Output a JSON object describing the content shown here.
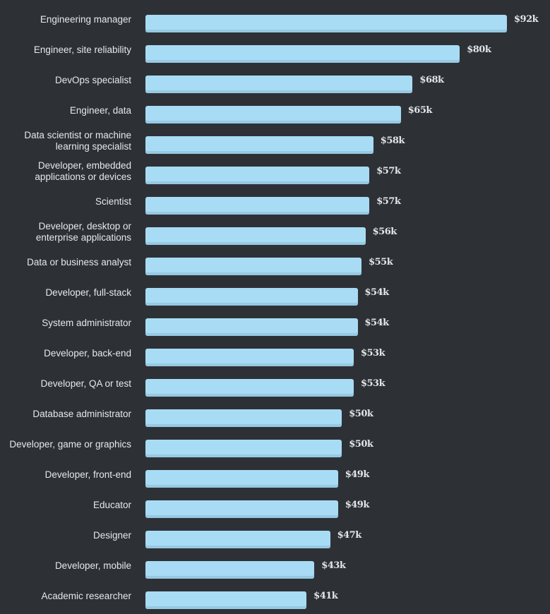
{
  "chart_data": {
    "type": "bar",
    "orientation": "horizontal",
    "title": "",
    "xlabel": "",
    "ylabel": "",
    "xlim": [
      0,
      92
    ],
    "grid": false,
    "value_prefix": "$",
    "value_suffix": "k",
    "categories": [
      "Engineering manager",
      "Engineer, site reliability",
      "DevOps specialist",
      "Engineer, data",
      "Data scientist or machine\nlearning specialist",
      "Developer, embedded\napplications or devices",
      "Scientist",
      "Developer, desktop or\nenterprise applications",
      "Data or business analyst",
      "Developer, full-stack",
      "System administrator",
      "Developer, back-end",
      "Developer, QA or test",
      "Database administrator",
      "Developer, game or graphics",
      "Developer, front-end",
      "Educator",
      "Designer",
      "Developer, mobile",
      "Academic researcher"
    ],
    "values": [
      92,
      80,
      68,
      65,
      58,
      57,
      57,
      56,
      55,
      54,
      54,
      53,
      53,
      50,
      50,
      49,
      49,
      47,
      43,
      41
    ],
    "data_labels": [
      "$92k",
      "$80k",
      "$68k",
      "$65k",
      "$58k",
      "$57k",
      "$57k",
      "$56k",
      "$55k",
      "$54k",
      "$54k",
      "$53k",
      "$53k",
      "$50k",
      "$50k",
      "$49k",
      "$49k",
      "$47k",
      "$43k",
      "$41k"
    ],
    "colors": {
      "bar": "#a8dcf4",
      "bar_shadow": "#97c9e2",
      "background": "#2d3136",
      "text": "#e6e8ea"
    }
  }
}
